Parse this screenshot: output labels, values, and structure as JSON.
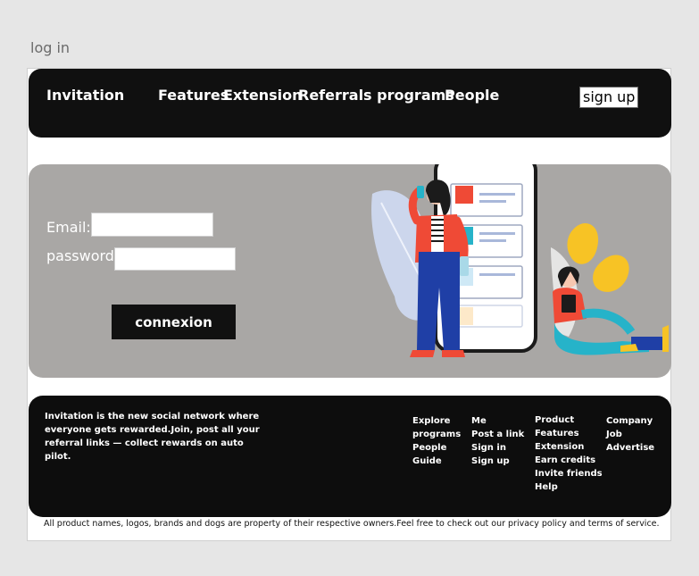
{
  "page": {
    "title": "log in"
  },
  "navbar": {
    "brand": "Invitation",
    "links": [
      "Features",
      "Extension",
      "Referrals programs",
      "People"
    ],
    "signup_label": "sign up"
  },
  "login": {
    "email_label": "Email:",
    "email_value": "",
    "password_label": "password:",
    "password_value": "",
    "submit_label": "connexion"
  },
  "footer": {
    "tagline": "Invitation is the new social network where everyone gets rewarded.Join, post all your  referral links — collect rewards on auto pilot.",
    "columns": [
      {
        "items": [
          "Explore",
          "programs",
          "People",
          "Guide"
        ]
      },
      {
        "items": [
          "Me",
          "Post a link",
          "Sign in",
          "Sign up"
        ]
      },
      {
        "items": [
          "Product",
          "Features",
          "Extension",
          "Earn credits",
          "Invite friends",
          "Help"
        ]
      },
      {
        "items": [
          "Company",
          "Job",
          "Advertise"
        ]
      }
    ]
  },
  "legal": "All product names, logos, brands and dogs are property of their respective owners.Feel free to check out our privacy policy and terms of service.",
  "colors": {
    "dark": "#101010",
    "hero_bg": "#a9a7a5",
    "accent_red": "#ef4a36",
    "accent_yellow": "#f7c325",
    "accent_blue": "#1f3fa6",
    "accent_teal": "#26b3c9"
  }
}
